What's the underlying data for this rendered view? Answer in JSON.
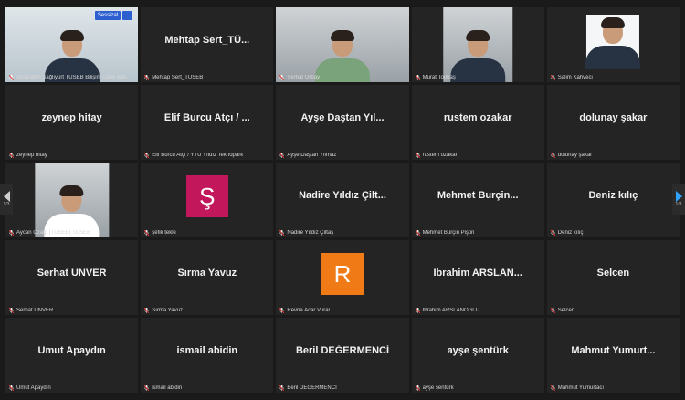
{
  "accent": "#e6f25a",
  "badge_color": "#2d5fd1",
  "mic_icon": "muted-mic-icon",
  "tiles": [
    {
      "center": "",
      "label": "Selahattin Sağlıyurt TÜSEB Bilişim Daire Bşk.",
      "video": "man-suit"
    },
    {
      "center": "Mehtap  Sert_TÜ...",
      "label": "Mehtap  Sert_TÜSEB",
      "video": ""
    },
    {
      "center": "",
      "label": "Serhat Orbay",
      "video": "man-headset"
    },
    {
      "center": "",
      "label": "Murat Topbaş",
      "video": "man-mic"
    },
    {
      "center": "",
      "label": "Salim Kahveci",
      "video": "man-photo"
    },
    {
      "center": "zeynep hitay",
      "label": "zeynep hitay"
    },
    {
      "center": "Elif Burcu Atçı / ...",
      "label": "Elif Burcu Atçı / YTÜ Yıldız Teknopark"
    },
    {
      "center": "Ayşe Daştan Yıl...",
      "label": "Ayşe Daştan Yılmaz"
    },
    {
      "center": "rustem ozakar",
      "label": "rustem ozakar"
    },
    {
      "center": "dolunay şakar",
      "label": "dolunay şakar"
    },
    {
      "center": "",
      "label": "Aycan Özalp (TÜSEB) TÜSEB",
      "video": "man-tie"
    },
    {
      "center": "",
      "label": "şefik tekle",
      "avatar": "Ş",
      "avatar_color": "#c2185b"
    },
    {
      "center": "Nadire Yıldız Çilt...",
      "label": "Nadire Yıldız Çiltaş"
    },
    {
      "center": "Mehmet  Burçin...",
      "label": "Mehmet Burçin Piştiri"
    },
    {
      "center": "Deniz kılıç",
      "label": "Deniz kılıç"
    },
    {
      "center": "Serhat ÜNVER",
      "label": "Serhat ÜNVER"
    },
    {
      "center": "Sırma Yavuz",
      "label": "Sırma Yavuz"
    },
    {
      "center": "",
      "label": "Revna Acar Vural",
      "avatar": "R",
      "avatar_color": "#f07a16"
    },
    {
      "center": "İbrahim  ARSLAN...",
      "label": "İbrahim ARSLANOĞLU"
    },
    {
      "center": "Selcen",
      "label": "Selcen"
    },
    {
      "center": "Umut Apaydın",
      "label": "Umut Apaydın"
    },
    {
      "center": "ismail abidin",
      "label": "ismail abidin"
    },
    {
      "center": "Beril DEĞERMENCİ",
      "label": "Beril DEĞERMENCİ"
    },
    {
      "center": "ayşe şentürk",
      "label": "ayşe şentürk"
    },
    {
      "center": "Mahmut  Yumurt...",
      "label": "Mahmut Yumurtacı"
    }
  ],
  "badges": [
    "Sessizal",
    "..."
  ],
  "page_indicator_left": "1/3",
  "page_indicator_right": "1/3"
}
